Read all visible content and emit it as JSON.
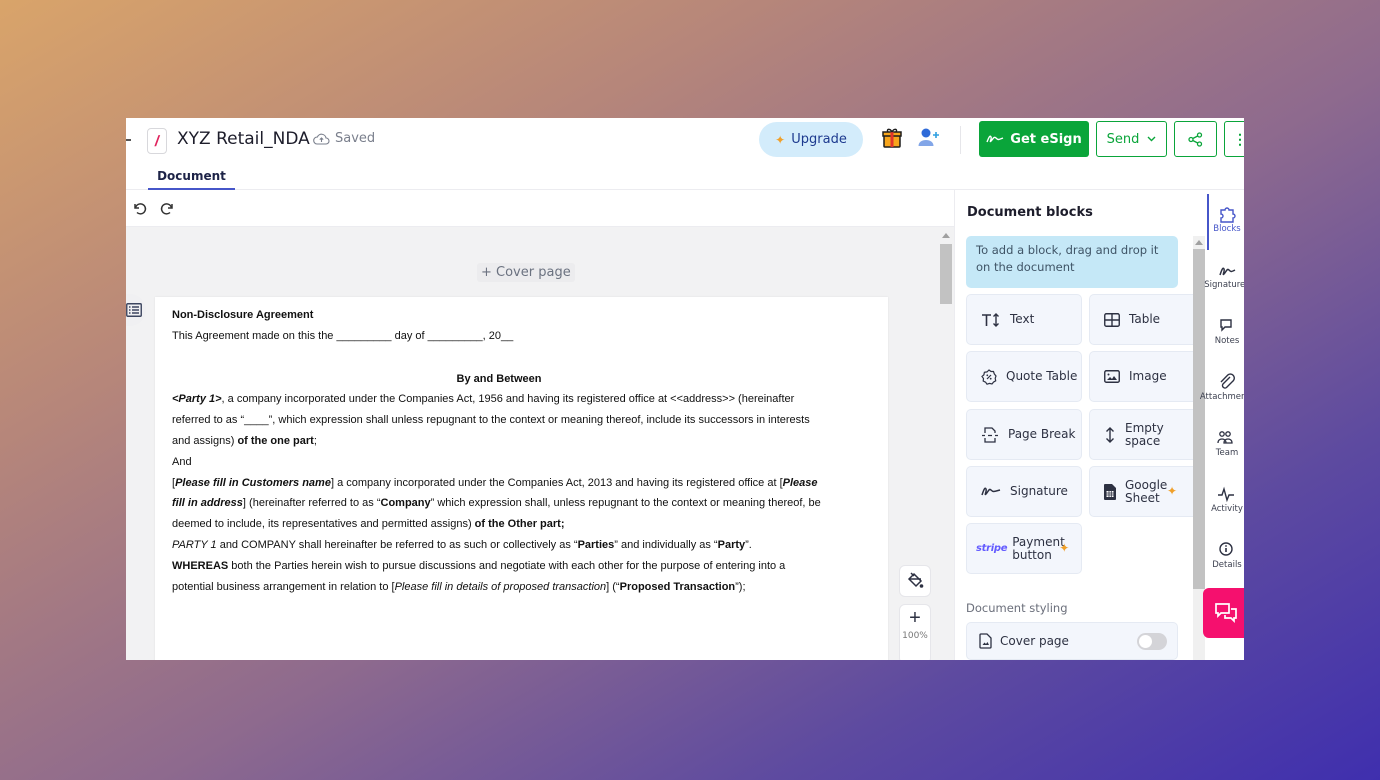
{
  "header": {
    "doc_title": "XYZ Retail_NDA",
    "save_status": "Saved",
    "upgrade_label": "Upgrade",
    "get_esign_label": "Get eSign",
    "send_label": "Send"
  },
  "tabs": [
    {
      "label": "Document",
      "active": true
    }
  ],
  "canvas": {
    "add_cover_label": "+ Cover page",
    "zoom_level": "100%"
  },
  "document": {
    "title": "Non-Disclosure Agreement",
    "intro": "This Agreement made on this the _________ day of _________, 20__",
    "by_and_between": "By and Between",
    "p1": {
      "party": "<Party 1>",
      "text": ", a company incorporated under the Companies Act, 1956 and having its registered office at <<address>> (hereinafter referred to as “____”, which expression shall unless repugnant to the context or meaning thereof, include its successors in interests and assigns) ",
      "end": "of the one part",
      "tail": ";"
    },
    "and": "And",
    "p2": {
      "customer": "Please fill in Customers name",
      "text1": " a company incorporated under the Companies Act, 2013 and having its registered office at ",
      "address": "Please fill in address",
      "text2": " (hereinafter referred to as “",
      "company": "Company",
      "text3": "” which expression shall, unless repugnant to the context or meaning thereof, be deemed to include, its representatives and permitted assigns) ",
      "end": "of the Other part;"
    },
    "p3": {
      "party1": "PARTY 1",
      "text1": " and COMPANY shall hereinafter be referred to as such or collectively as “",
      "parties": "Parties",
      "text2": "” and individually as “",
      "party": "Party",
      "text3": "”."
    },
    "p4": {
      "whereas": "WHEREAS",
      "text1": " both the Parties herein wish to pursue discussions and negotiate with each other for the purpose of entering into a potential business arrangement in relation to [",
      "details": "Please fill in details of proposed transaction",
      "text2": "] (“",
      "proposed": "Proposed Transaction",
      "text3": "”);"
    }
  },
  "panel": {
    "title": "Document blocks",
    "hint": "To add a block, drag and drop it on the document",
    "blocks": [
      {
        "label": "Text",
        "icon": "text-size-icon"
      },
      {
        "label": "Table",
        "icon": "table-icon"
      },
      {
        "label": "Quote Table",
        "icon": "quote-table-icon"
      },
      {
        "label": "Image",
        "icon": "image-icon"
      },
      {
        "label": "Page Break",
        "icon": "page-break-icon"
      },
      {
        "label": "Empty space",
        "icon": "vertical-arrows-icon"
      },
      {
        "label": "Signature",
        "icon": "signature-icon"
      },
      {
        "label": "Google Sheet",
        "icon": "spreadsheet-icon",
        "premium": true
      },
      {
        "label": "Payment button",
        "icon": "stripe-logo",
        "premium": true,
        "brand": "stripe"
      }
    ],
    "styling_label": "Document styling",
    "cover_page_label": "Cover page",
    "cover_page_enabled": false
  },
  "rail": {
    "items": [
      {
        "label": "Blocks",
        "icon": "puzzle-icon",
        "active": true
      },
      {
        "label": "Signatures",
        "icon": "signature-icon"
      },
      {
        "label": "Notes",
        "icon": "comments-icon"
      },
      {
        "label": "Attachments",
        "icon": "paperclip-icon"
      },
      {
        "label": "Team",
        "icon": "team-icon"
      },
      {
        "label": "Activity",
        "icon": "activity-icon"
      },
      {
        "label": "Details",
        "icon": "info-icon"
      }
    ]
  },
  "colors": {
    "accent": "#4656c9",
    "esign_green": "#0aa53a",
    "chat_pink": "#f5106e",
    "hint_blue": "#c5e8f7"
  }
}
